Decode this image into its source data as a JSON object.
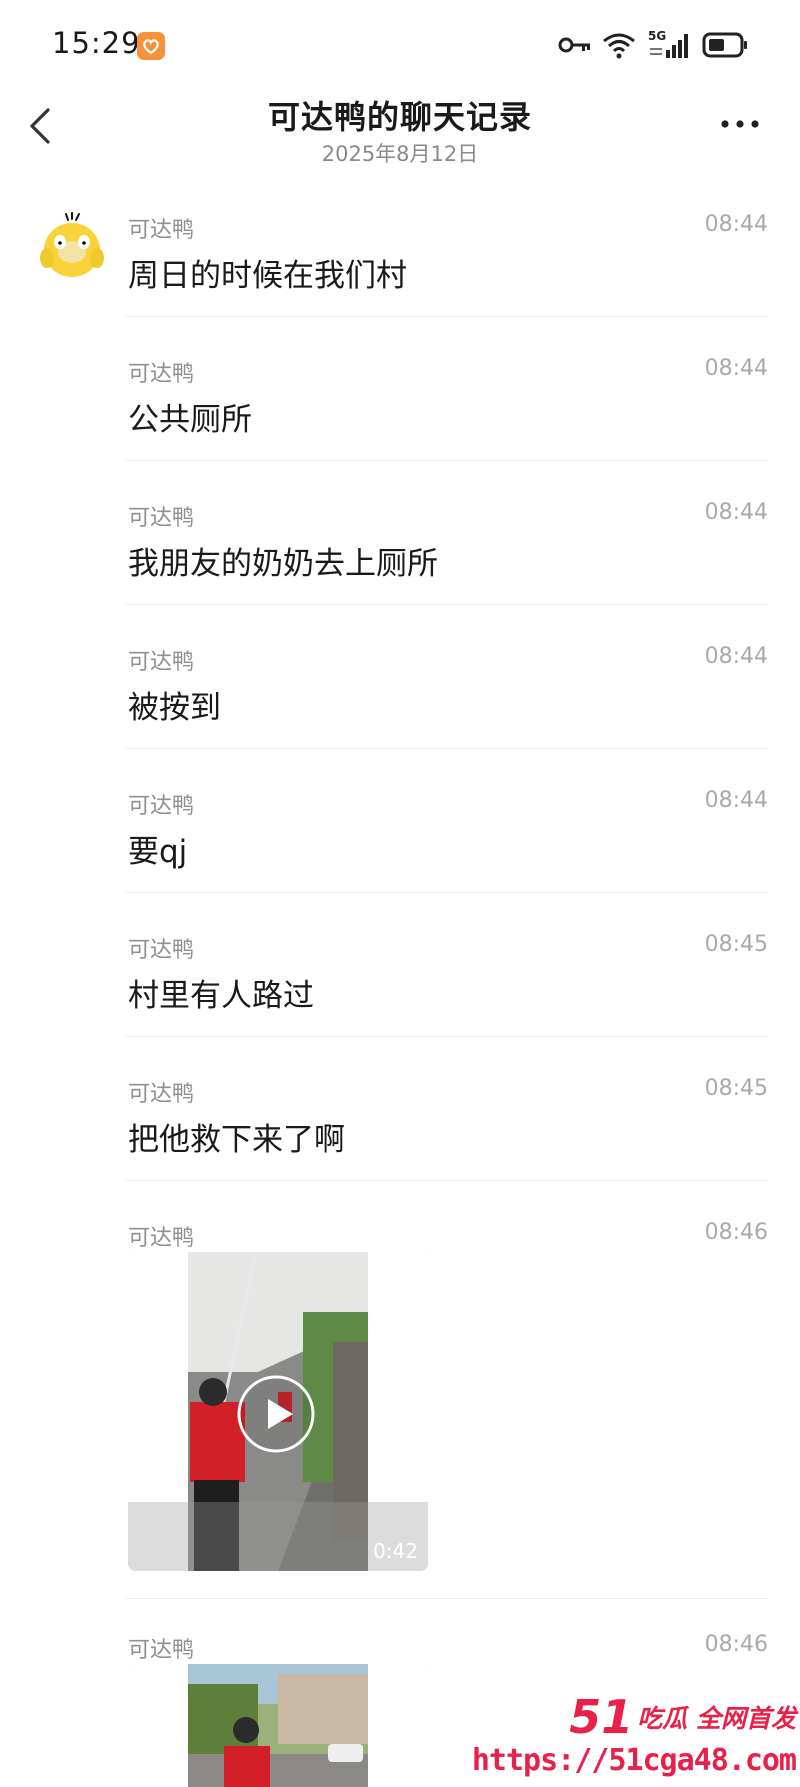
{
  "status_bar": {
    "time": "15:29",
    "app_icon": "heart-badge-icon",
    "network": "5G",
    "icons": [
      "key-icon",
      "wifi-icon",
      "signal-5g-icon",
      "battery-icon"
    ]
  },
  "header": {
    "title": "可达鸭的聊天记录",
    "subtitle": "2025年8月12日",
    "back_icon": "chevron-left-icon",
    "more_icon": "more-dots-icon"
  },
  "messages": [
    {
      "sender": "可达鸭",
      "time": "08:44",
      "text": "周日的时候在我们村"
    },
    {
      "sender": "可达鸭",
      "time": "08:44",
      "text": "公共厕所"
    },
    {
      "sender": "可达鸭",
      "time": "08:44",
      "text": "我朋友的奶奶去上厕所"
    },
    {
      "sender": "可达鸭",
      "time": "08:44",
      "text": "被按到"
    },
    {
      "sender": "可达鸭",
      "time": "08:44",
      "text": "要qj"
    },
    {
      "sender": "可达鸭",
      "time": "08:45",
      "text": "村里有人路过"
    },
    {
      "sender": "可达鸭",
      "time": "08:45",
      "text": "把他救下来了啊"
    },
    {
      "sender": "可达鸭",
      "time": "08:46",
      "video": {
        "duration": "0:42",
        "icon": "play-icon"
      }
    },
    {
      "sender": "可达鸭",
      "time": "08:46",
      "video": {
        "duration": "",
        "icon": "play-icon"
      }
    }
  ],
  "watermark": {
    "brand": "51",
    "tagline": "吃瓜 全网首发",
    "url": "https://51cga48.com"
  },
  "colors": {
    "accent": "#e8204a",
    "app_icon": "#f7913a",
    "divider": "#ececec",
    "secondary_text": "#8f8f8f"
  }
}
